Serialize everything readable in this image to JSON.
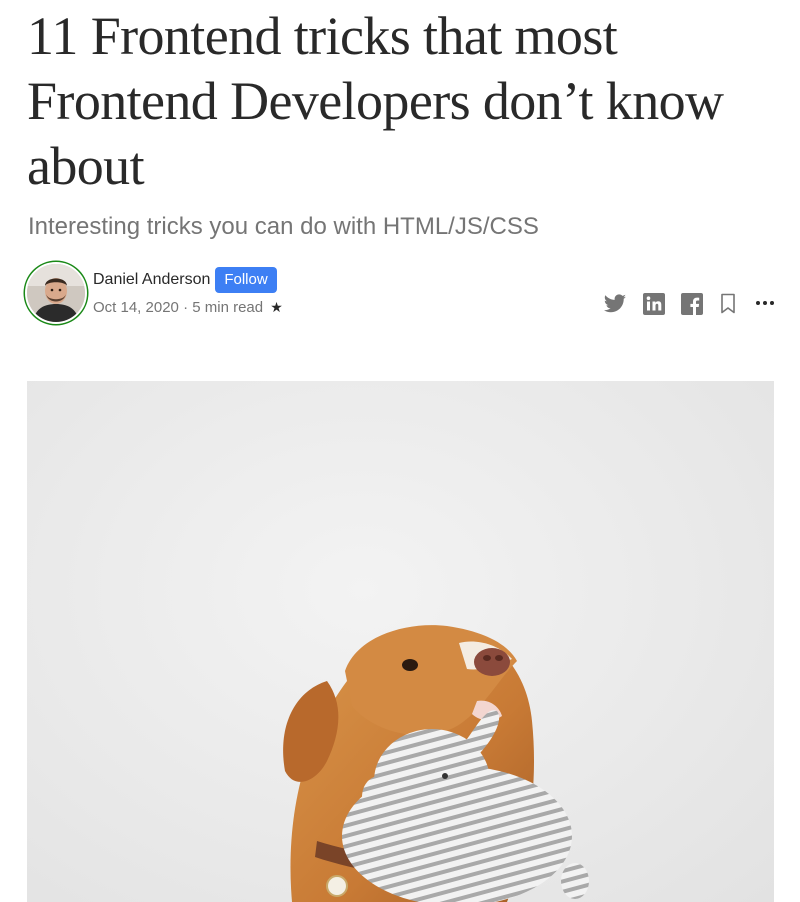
{
  "article": {
    "title": "11 Frontend tricks that most Frontend Developers don’t know about",
    "subtitle": "Interesting tricks you can do with HTML/JS/CSS"
  },
  "author": {
    "name": "Daniel Anderson",
    "follow_label": "Follow",
    "date": "Oct 14, 2020",
    "separator": "·",
    "read_time": "5 min read",
    "member_star": "★"
  },
  "share": {
    "icons": [
      "twitter-icon",
      "linkedin-icon",
      "facebook-icon",
      "bookmark-icon",
      "more-icon"
    ]
  },
  "colors": {
    "follow_button": "#3d7ff4",
    "avatar_ring": "#1a8917",
    "text_primary": "#292929",
    "text_secondary": "#757575"
  }
}
